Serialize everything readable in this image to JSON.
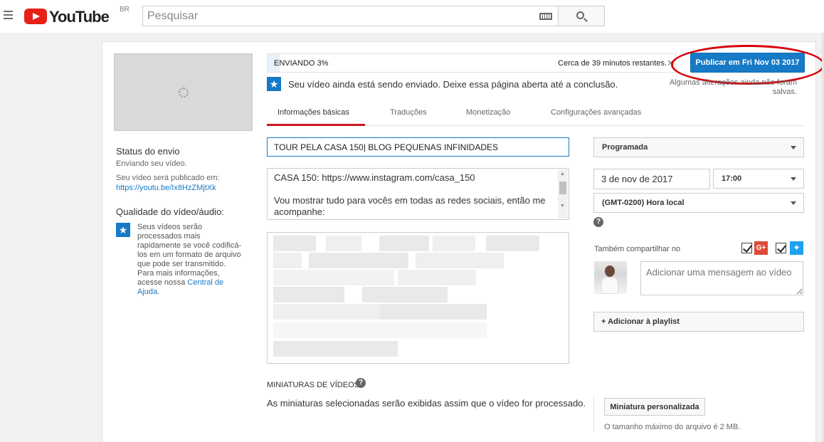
{
  "header": {
    "logo_text": "YouTube",
    "region": "BR",
    "search_placeholder": "Pesquisar"
  },
  "upload": {
    "progress_label": "ENVIANDO 3%",
    "progress_percent": 3,
    "time_remaining": "Cerca de 39 minutos restantes.",
    "publish_button": "Publicar em Fri Nov 03 2017",
    "unsaved_note": "Algumas alterações ainda não foram salvas.",
    "notice": "Seu vídeo ainda está sendo enviado. Deixe essa página aberta até a conclusão."
  },
  "sidebar": {
    "status_title": "Status do envio",
    "status_text": "Enviando seu vídeo.",
    "publish_url_label": "Seu vídeo será publicado em:",
    "publish_url": "https://youtu.be/Ix8HzZMjtXk",
    "quality_title": "Qualidade do vídeo/áudio:",
    "quality_text": "Seus vídeos serão processados mais rapidamente se você codificá-los em um formato de arquivo que pode ser transmitido. Para mais informações, acesse nossa",
    "help_link": "Central de Ajuda",
    "period": "."
  },
  "tabs": [
    {
      "label": "Informações básicas",
      "active": true
    },
    {
      "label": "Traduções",
      "active": false
    },
    {
      "label": "Monetização",
      "active": false
    },
    {
      "label": "Configurações avançadas",
      "active": false
    }
  ],
  "form": {
    "title_value": "TOUR PELA CASA 150| BLOG PEQUENAS INFINIDADES",
    "description_line1": "CASA 150: https://www.instagram.com/casa_150",
    "description_line2": "Vou mostrar tudo para vocês em todas as redes sociais, então me acompanhe:",
    "thumbnails_title": "MINIATURAS DE VÍDEOS",
    "thumbnails_note": "As miniaturas selecionadas serão exibidas assim que o vídeo for processado.",
    "custom_thumbnail_button": "Miniatura personalizada",
    "max_size_note": "O tamanho máximo do arquivo é 2 MB."
  },
  "settings": {
    "visibility": "Programada",
    "date": "3 de nov de 2017",
    "time": "17:00",
    "timezone": "(GMT-0200) Hora local",
    "share_label": "Também compartilhar no",
    "share_placeholder": "Adicionar uma mensagem ao vídeo",
    "playlist_button": "+ Adicionar à playlist",
    "gplus_text": "G+"
  },
  "colors": {
    "accent": "#167ac6",
    "youtube_red": "#e62117",
    "tab_underline": "#cc181e",
    "highlight_ellipse": "#d6000b"
  }
}
